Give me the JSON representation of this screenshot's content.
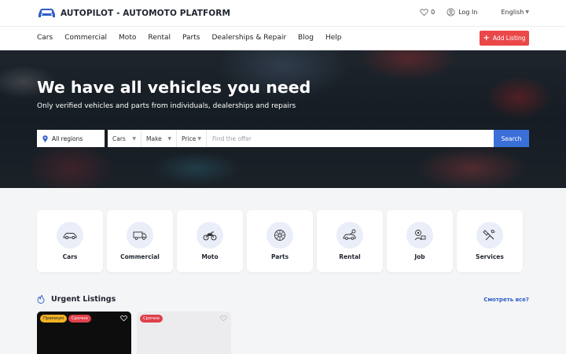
{
  "header": {
    "logo_text": "AUTOPILOT - AUTOMOTO PLATFORM",
    "favorites_count": "0",
    "login_label": "Log In",
    "language": "English"
  },
  "nav": {
    "items": [
      "Cars",
      "Commercial",
      "Moto",
      "Rental",
      "Parts",
      "Dealerships & Repair",
      "Blog",
      "Help"
    ],
    "add_listing_label": "Add Listing"
  },
  "hero": {
    "title": "We have all vehicles you need",
    "subtitle": "Only verified vehicles and parts from individuals, dealerships and repairs"
  },
  "search": {
    "region": "All regions",
    "type": "Cars",
    "make": "Make",
    "price": "Price",
    "placeholder": "Find the offer",
    "button_label": "Search"
  },
  "categories": [
    {
      "label": "Cars",
      "icon": "car-icon"
    },
    {
      "label": "Commercial",
      "icon": "truck-icon"
    },
    {
      "label": "Moto",
      "icon": "motorcycle-icon"
    },
    {
      "label": "Parts",
      "icon": "wheel-icon"
    },
    {
      "label": "Rental",
      "icon": "rental-car-icon"
    },
    {
      "label": "Job",
      "icon": "job-icon"
    },
    {
      "label": "Services",
      "icon": "services-icon"
    }
  ],
  "urgent": {
    "title": "Urgent Listings",
    "see_all": "Смотреть все?",
    "cards": [
      {
        "badges": [
          "Премиум",
          "Срочно"
        ]
      },
      {
        "badges": [
          "Срочно"
        ]
      }
    ]
  },
  "colors": {
    "accent_blue": "#3a6fd8",
    "add_button_red": "#ea4848",
    "premium_yellow": "#f2b323",
    "urgent_red": "#e0404a"
  }
}
